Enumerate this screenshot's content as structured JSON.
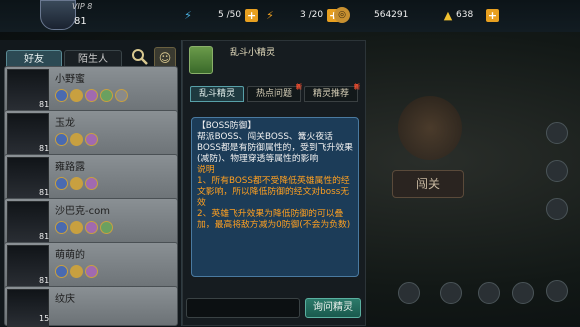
{
  "topbar": {
    "level": "81",
    "vip": "VIP 8",
    "stamina": "5 /50",
    "skill": "3 /20",
    "gold": "564291",
    "ingot": "638",
    "plus": "+"
  },
  "left_tabs": {
    "friends": "好友",
    "strangers": "陌生人"
  },
  "friends": [
    {
      "name": "小野蜜",
      "level": "81"
    },
    {
      "name": "玉龙",
      "level": "81"
    },
    {
      "name": "雍路露",
      "level": "81"
    },
    {
      "name": "沙巴克-com",
      "level": "81"
    },
    {
      "name": "萌萌的",
      "level": "81"
    },
    {
      "name": "纹庆",
      "level": "15"
    }
  ],
  "sprite": {
    "title": "乱斗小精灵",
    "tabs": [
      "乱斗精灵",
      "热点问题",
      "精灵推荐"
    ],
    "new_badge": "新",
    "message": {
      "heading": "【BOSS防御】",
      "body": "帮派BOSS、闯关BOSS、篝火夜话BOSS都是有防御属性的，受到飞升效果(减防)、物理穿透等属性的影响",
      "note_label": "说明",
      "note1": "1、所有BOSS都不受降低英雄属性的经文影响，所以降低防御的经文对boss无效",
      "note2": "2、英雄飞升效果为降低防御的可以叠加，最高将敌方减为0防御(不会为负数)"
    },
    "ask_button": "询问精灵"
  },
  "background": {
    "stage_label": "闯关"
  },
  "colors": {
    "accent": "#2c7a6a",
    "message_bg": "#1c3c58",
    "highlight": "#ffa020"
  }
}
